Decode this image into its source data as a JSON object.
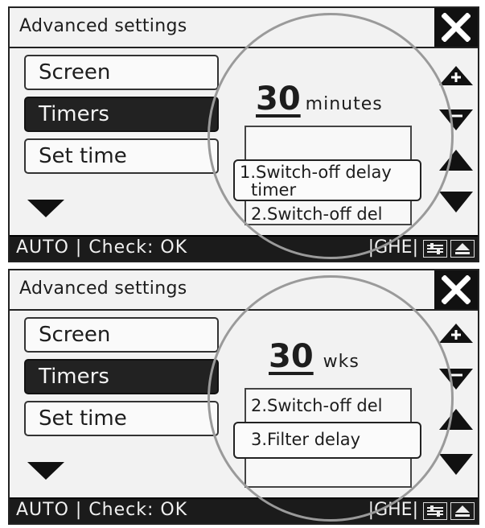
{
  "panels": [
    {
      "title": "Advanced settings",
      "menu": [
        "Screen",
        "Timers",
        "Set time"
      ],
      "value": "30",
      "unit": "minutes",
      "list_items": [
        "2.Switch-off del"
      ],
      "popup": [
        "1.Switch-off delay",
        "timer"
      ],
      "status": "AUTO | Check: OK",
      "status_code": "|GHE|"
    },
    {
      "title": "Advanced settings",
      "menu": [
        "Screen",
        "Timers",
        "Set time"
      ],
      "value": "30",
      "unit": "wks",
      "list_items": [
        "2.Switch-off del"
      ],
      "popup": [
        "3.Filter delay"
      ],
      "status": "AUTO | Check: OK",
      "status_code": "|GHE|"
    }
  ],
  "icons": {
    "close": "close-icon",
    "plus": "plus-triangle-icon",
    "minus": "minus-triangle-icon",
    "up": "arrow-up-icon",
    "down": "arrow-down-icon",
    "settings": "sliders-icon",
    "eject": "eject-icon"
  },
  "colors": {
    "dark": "#1b1b1b",
    "light": "#f2f2f2",
    "circle": "#9a9a9a"
  }
}
